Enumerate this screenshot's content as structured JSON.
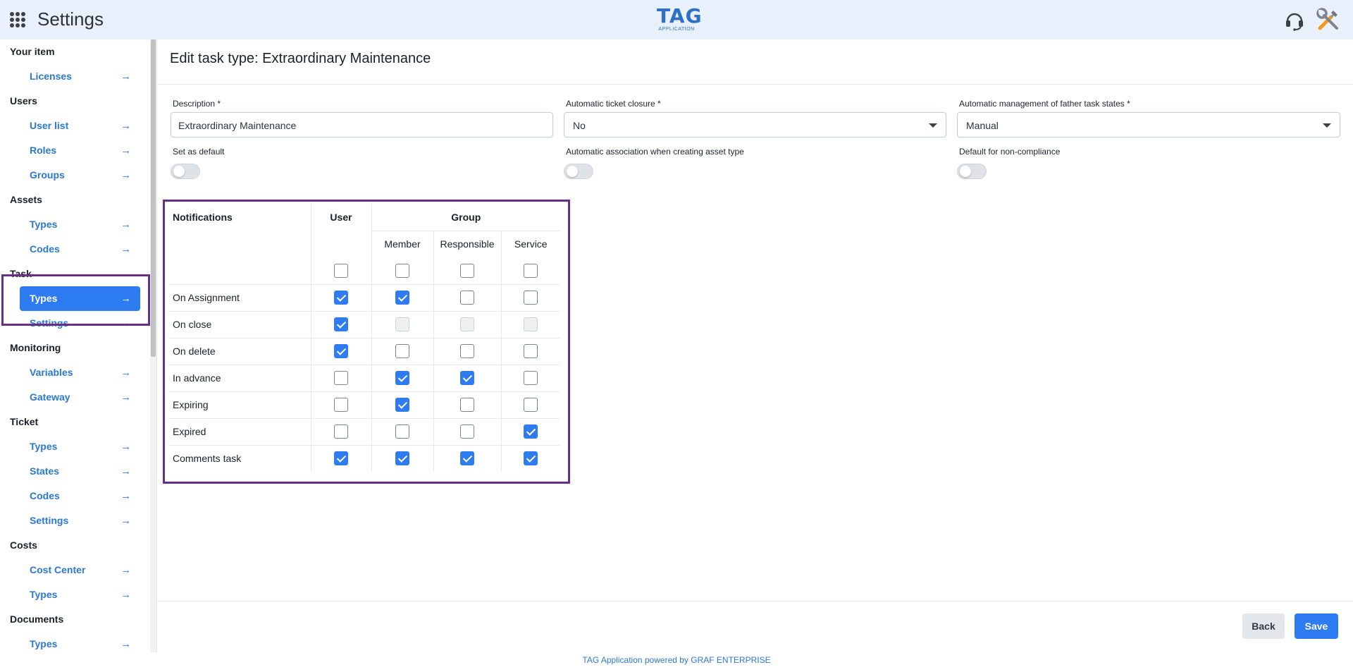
{
  "header": {
    "title": "Settings",
    "logo_main": "TAG",
    "logo_sub": "APPLICATION"
  },
  "sidebar": {
    "sections": [
      {
        "label": "Your item",
        "items": [
          {
            "label": "Licenses"
          }
        ]
      },
      {
        "label": "Users",
        "items": [
          {
            "label": "User list"
          },
          {
            "label": "Roles"
          },
          {
            "label": "Groups"
          }
        ]
      },
      {
        "label": "Assets",
        "items": [
          {
            "label": "Types"
          },
          {
            "label": "Codes"
          }
        ]
      },
      {
        "label": "Task",
        "items": [
          {
            "label": "Types",
            "active": true
          },
          {
            "label": "Settings"
          }
        ]
      },
      {
        "label": "Monitoring",
        "items": [
          {
            "label": "Variables"
          },
          {
            "label": "Gateway"
          }
        ]
      },
      {
        "label": "Ticket",
        "items": [
          {
            "label": "Types"
          },
          {
            "label": "States"
          },
          {
            "label": "Codes"
          },
          {
            "label": "Settings"
          }
        ]
      },
      {
        "label": "Costs",
        "items": [
          {
            "label": "Cost Center"
          },
          {
            "label": "Types"
          }
        ]
      },
      {
        "label": "Documents",
        "items": [
          {
            "label": "Types"
          }
        ]
      }
    ]
  },
  "page": {
    "title": "Edit task type: Extraordinary Maintenance"
  },
  "form": {
    "description_label": "Description *",
    "description_value": "Extraordinary Maintenance",
    "ticket_closure_label": "Automatic ticket closure *",
    "ticket_closure_value": "No",
    "father_states_label": "Automatic management of father task states *",
    "father_states_value": "Manual",
    "set_default_label": "Set as default",
    "auto_assoc_label": "Automatic association when creating asset type",
    "non_compliance_label": "Default for non-compliance"
  },
  "notifications": {
    "header_notifications": "Notifications",
    "header_user": "User",
    "header_group": "Group",
    "sub_member": "Member",
    "sub_responsible": "Responsible",
    "sub_service": "Service",
    "select_all": [
      false,
      false,
      false,
      false
    ],
    "rows": [
      {
        "label": "On Assignment",
        "values": [
          true,
          true,
          false,
          false
        ],
        "disabled": [
          false,
          false,
          false,
          false
        ]
      },
      {
        "label": "On close",
        "values": [
          true,
          false,
          false,
          false
        ],
        "disabled": [
          false,
          true,
          true,
          true
        ]
      },
      {
        "label": "On delete",
        "values": [
          true,
          false,
          false,
          false
        ],
        "disabled": [
          false,
          false,
          false,
          false
        ]
      },
      {
        "label": "In advance",
        "values": [
          false,
          true,
          true,
          false
        ],
        "disabled": [
          false,
          false,
          false,
          false
        ]
      },
      {
        "label": "Expiring",
        "values": [
          false,
          true,
          false,
          false
        ],
        "disabled": [
          false,
          false,
          false,
          false
        ]
      },
      {
        "label": "Expired",
        "values": [
          false,
          false,
          false,
          true
        ],
        "disabled": [
          false,
          false,
          false,
          false
        ]
      },
      {
        "label": "Comments task",
        "values": [
          true,
          true,
          true,
          true
        ],
        "disabled": [
          false,
          false,
          false,
          false
        ]
      }
    ]
  },
  "actions": {
    "back_label": "Back",
    "save_label": "Save"
  },
  "footer": {
    "powered_by": "TAG Application powered by GRAF ENTERPRISE"
  },
  "colors": {
    "accent": "#2d7bf0",
    "highlight_border": "#6a2f86",
    "header_bg": "#e8f0fb"
  }
}
